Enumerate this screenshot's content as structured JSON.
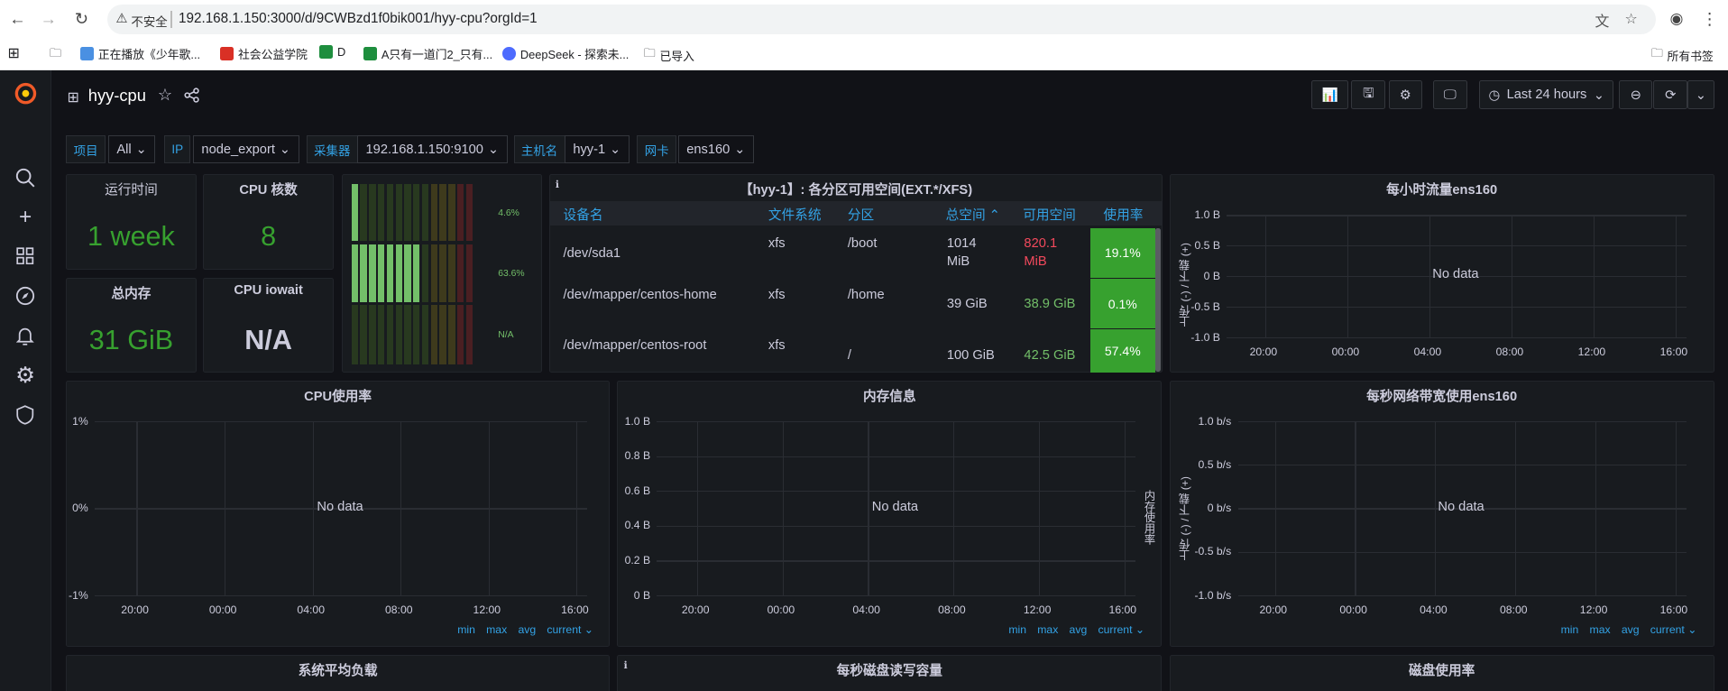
{
  "browser": {
    "insecure": "不安全",
    "url": "192.168.1.150:3000/d/9CWBzd1f0bik001/hyy-cpu?orgId=1",
    "bookmarks": [
      "正在播放《少年歌...",
      "社会公益学院",
      "D",
      "A只有一道门2_只有...",
      "DeepSeek - 探索未...",
      "已导入"
    ],
    "all_bookmarks": "所有书签"
  },
  "dashboard": {
    "title": "hyy-cpu",
    "time_range": "Last 24 hours"
  },
  "variables": [
    {
      "label": "项目",
      "value": "All"
    },
    {
      "label": "IP",
      "value": "node_export"
    },
    {
      "label": "采集器",
      "value": "192.168.1.150:9100"
    },
    {
      "label": "主机名",
      "value": "hyy-1"
    },
    {
      "label": "网卡",
      "value": "ens160"
    }
  ],
  "stats": {
    "uptime": {
      "title": "运行时间",
      "value": "1 week"
    },
    "cpu_cores": {
      "title": "CPU 核数",
      "value": "8"
    },
    "mem_total": {
      "title": "总内存",
      "value": "31 GiB"
    },
    "iowait": {
      "title": "CPU iowait",
      "value": "N/A"
    }
  },
  "gauges": {
    "labels": [
      "4.6%",
      "63.6%",
      "N/A"
    ],
    "levels": [
      0.046,
      0.636,
      0
    ]
  },
  "disk_table": {
    "title": "【hyy-1】: 各分区可用空间(EXT.*/XFS)",
    "headers": [
      "设备名",
      "文件系统",
      "分区",
      "总空间 ⌃",
      "可用空间",
      "使用率"
    ],
    "rows": [
      {
        "dev": "/dev/sda1",
        "fs": "xfs",
        "mount": "/boot",
        "total": "1014",
        "total_unit": "MiB",
        "avail": "820.1",
        "avail_unit": "MiB",
        "usage": "19.1%"
      },
      {
        "dev": "/dev/mapper/centos-home",
        "fs": "xfs",
        "mount": "/home",
        "total": "39 GiB",
        "avail": "38.9 GiB",
        "usage": "0.1%"
      },
      {
        "dev": "/dev/mapper/centos-root",
        "fs": "xfs",
        "mount": "/",
        "total": "100 GiB",
        "avail": "42.5 GiB",
        "usage": "57.4%"
      }
    ]
  },
  "panels": {
    "traffic": {
      "title": "每小时流量ens160",
      "yticks": [
        "1.0 B",
        "0.5 B",
        "0 B",
        "-0.5 B",
        "-1.0 B"
      ],
      "xticks": [
        "20:00",
        "00:00",
        "04:00",
        "08:00",
        "12:00",
        "16:00"
      ],
      "ylabel": "上传 (-) / 下载 (+)",
      "nodata": "No data"
    },
    "cpu": {
      "title": "CPU使用率",
      "yticks": [
        "1%",
        "0%",
        "-1%"
      ],
      "xticks": [
        "20:00",
        "00:00",
        "04:00",
        "08:00",
        "12:00",
        "16:00"
      ],
      "nodata": "No data"
    },
    "mem": {
      "title": "内存信息",
      "yticks": [
        "1.0 B",
        "0.8 B",
        "0.6 B",
        "0.4 B",
        "0.2 B",
        "0 B"
      ],
      "xticks": [
        "20:00",
        "00:00",
        "04:00",
        "08:00",
        "12:00",
        "16:00"
      ],
      "ylabel_right": "内存使用率",
      "nodata": "No data"
    },
    "bw": {
      "title": "每秒网络带宽使用ens160",
      "yticks": [
        "1.0 b/s",
        "0.5 b/s",
        "0 b/s",
        "-0.5 b/s",
        "-1.0 b/s"
      ],
      "xticks": [
        "20:00",
        "00:00",
        "04:00",
        "08:00",
        "12:00",
        "16:00"
      ],
      "ylabel": "上传 (-) / 下载 (+)",
      "nodata": "No data"
    },
    "load": {
      "title": "系统平均负载"
    },
    "diskio": {
      "title": "每秒磁盘读写容量"
    },
    "diskuse": {
      "title": "磁盘使用率"
    }
  },
  "legend": [
    "min",
    "max",
    "avg",
    "current ⌄"
  ],
  "colors": {
    "stat_green": "#73bf69",
    "bg": "#111217",
    "panel": "#181b1f",
    "link": "#33a2e5",
    "usage_cell": "#37a12f",
    "red": "#f2495c"
  }
}
